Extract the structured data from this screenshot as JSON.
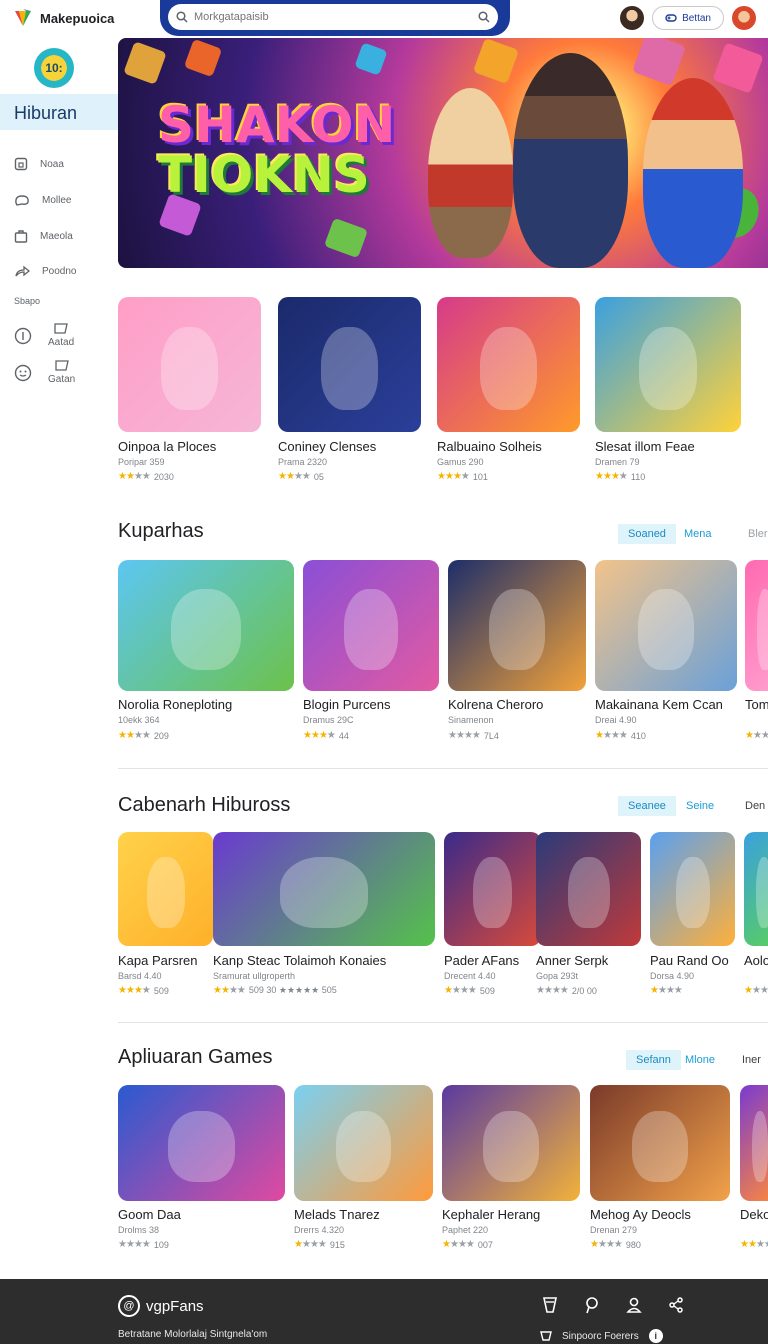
{
  "header": {
    "brand_name": "Makepuoica",
    "search_placeholder": "Morkgatapaisib",
    "action_label": "Bettan"
  },
  "sidebar": {
    "logo_text": "10:",
    "active_label": "Hiburan",
    "items": [
      {
        "label": "Noaa",
        "icon": "home-icon"
      },
      {
        "label": "Mollee",
        "icon": "chat-icon"
      },
      {
        "label": "Maeola",
        "icon": "bag-icon"
      },
      {
        "label": "Poodno",
        "icon": "share-icon"
      }
    ],
    "section_label": "Sbapo",
    "mini_items": [
      {
        "label": "Aatad",
        "icon": "info-icon"
      },
      {
        "label": "Gatan",
        "icon": "smile-icon"
      }
    ]
  },
  "hero": {
    "title_line1": "SHAKON",
    "title_line2": "TIOKNS"
  },
  "rows": [
    {
      "title": "",
      "chips": [],
      "cards": [
        {
          "title": "Oinpoa la Ploces",
          "meta": "Poripar 359",
          "stars": 2,
          "rating": "2030",
          "colors": [
            "#ff9ec7",
            "#f6b6d6"
          ]
        },
        {
          "title": "Coniney Clenses",
          "meta": "Prama 2320",
          "stars": 2,
          "rating": "05",
          "colors": [
            "#1b2a6b",
            "#2b3f9a"
          ]
        },
        {
          "title": "Ralbuaino Solheis",
          "meta": "Gamus 290",
          "stars": 3,
          "rating": "101",
          "colors": [
            "#d63b8a",
            "#ff9a2a"
          ]
        },
        {
          "title": "Slesat illom Feae",
          "meta": "Dramen 79",
          "stars": 3,
          "rating": "110",
          "colors": [
            "#3aa0e0",
            "#ffd23a"
          ]
        }
      ]
    },
    {
      "title": "Kuparhas",
      "chips": [
        "Soaned",
        "Mena",
        "Bler"
      ],
      "cards": [
        {
          "title": "Norolia Roneploting",
          "meta": "10ekk 364",
          "stars": 2,
          "rating": "209",
          "colors": [
            "#5cc6f2",
            "#6cc24a"
          ]
        },
        {
          "title": "Blogin Purcens",
          "meta": "Dramus 29C",
          "stars": 3,
          "rating": "44",
          "colors": [
            "#8a4fd6",
            "#e25aa2"
          ]
        },
        {
          "title": "Kolrena Cheroro",
          "meta": "Sinamenon",
          "stars": 0,
          "rating": "7L4",
          "colors": [
            "#1d2e6a",
            "#f2a23a"
          ]
        },
        {
          "title": "Makainana Kem Ccan",
          "meta": "Dreai 4.90",
          "stars": 1,
          "rating": "410",
          "colors": [
            "#f2c38a",
            "#6aa0d8"
          ]
        },
        {
          "title": "Tom",
          "meta": "",
          "stars": 1,
          "rating": "",
          "colors": [
            "#ff6ab0",
            "#ffa0d0"
          ]
        }
      ]
    },
    {
      "title": "Cabenarh Hibuross",
      "chips": [
        "Seanee",
        "Seine",
        "Den"
      ],
      "cards": [
        {
          "title": "Kapa Parsren",
          "meta": "Barsd 4.40",
          "stars": 3,
          "rating": "509",
          "colors": [
            "#ffd24a",
            "#ffb02a"
          ]
        },
        {
          "title": "Kanp Steac Tolaimoh Konaies",
          "meta": "Sramurat ullgroperth",
          "stars": 2,
          "rating": "509 30 ★★★★★ 505",
          "colors": [
            "#6a3ad0",
            "#55c24a"
          ]
        },
        {
          "title": "Pader AFans",
          "meta": "Drecent 4.40",
          "stars": 1,
          "rating": "509",
          "colors": [
            "#3a2a8a",
            "#d84a3a"
          ]
        },
        {
          "title": "Anner Serpk",
          "meta": "Gopa 293t",
          "stars": 0,
          "rating": "2/0 00",
          "colors": [
            "#2a3a7a",
            "#c03a3a"
          ]
        },
        {
          "title": "Pau Rand Oo",
          "meta": "Dorsa 4.90",
          "stars": 1,
          "rating": "",
          "colors": [
            "#5aa0f0",
            "#ffb03a"
          ]
        },
        {
          "title": "Aolo",
          "meta": "",
          "stars": 1,
          "rating": "",
          "colors": [
            "#3aa0e0",
            "#5ad05a"
          ]
        }
      ]
    },
    {
      "title": "Apliuaran Games",
      "chips": [
        "Sefann",
        "Mlone",
        "Iner"
      ],
      "cards": [
        {
          "title": "Goom Daa",
          "meta": "Drolms 38",
          "stars": 0,
          "rating": "109",
          "colors": [
            "#2a5ad0",
            "#e04aa0"
          ]
        },
        {
          "title": "Melads Tnarez",
          "meta": "Drerrs 4.320",
          "stars": 1,
          "rating": "915",
          "colors": [
            "#7ad0f2",
            "#ff9a3a"
          ]
        },
        {
          "title": "Kephaler Herang",
          "meta": "Paphet 220",
          "stars": 1,
          "rating": "007",
          "colors": [
            "#5a3aa0",
            "#f2b23a"
          ]
        },
        {
          "title": "Mehog Ay Deocls",
          "meta": "Drenan 279",
          "stars": 1,
          "rating": "980",
          "colors": [
            "#7a3a2a",
            "#f2a24a"
          ]
        },
        {
          "title": "Deko",
          "meta": "",
          "stars": 2,
          "rating": "",
          "colors": [
            "#7a3ad0",
            "#ff8a3a"
          ]
        }
      ]
    }
  ],
  "footer": {
    "brand": "vgpFans",
    "tagline": "Betratane Molorlalaj Sintgnela'om",
    "right_text": "Sinpoorc Foerers",
    "icons": [
      "drink-icon",
      "location-icon",
      "person-icon",
      "share-icon"
    ]
  }
}
